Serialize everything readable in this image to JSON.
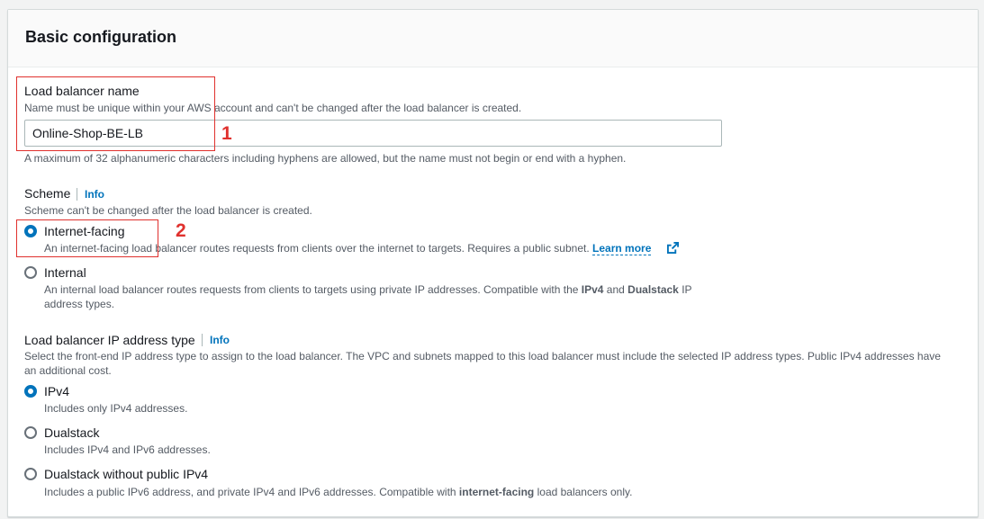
{
  "section": {
    "title": "Basic configuration"
  },
  "lb_name": {
    "label": "Load balancer name",
    "description": "Name must be unique within your AWS account and can't be changed after the load balancer is created.",
    "value": "Online-Shop-BE-LB",
    "constraint": "A maximum of 32 alphanumeric characters including hyphens are allowed, but the name must not begin or end with a hyphen."
  },
  "scheme": {
    "label": "Scheme",
    "info": "Info",
    "description": "Scheme can't be changed after the load balancer is created.",
    "options": [
      {
        "label": "Internet-facing",
        "checked": true,
        "description": "An internet-facing load balancer routes requests from clients over the internet to targets. Requires a public subnet.",
        "link": "Learn more"
      },
      {
        "label": "Internal",
        "checked": false,
        "desc_1": "An internal load balancer routes requests from clients to targets using private IP addresses. Compatible with the ",
        "desc_b1": "IPv4",
        "desc_2": " and ",
        "desc_b2": "Dualstack",
        "desc_3": " IP",
        "desc_line2": "address types."
      }
    ]
  },
  "ip_type": {
    "label": "Load balancer IP address type",
    "info": "Info",
    "description_line1": "Select the front-end IP address type to assign to the load balancer. The VPC and subnets mapped to this load balancer must include the selected IP address types. Public IPv4 addresses have",
    "description_line2": "an additional cost.",
    "options": [
      {
        "label": "IPv4",
        "checked": true,
        "description": "Includes only IPv4 addresses."
      },
      {
        "label": "Dualstack",
        "checked": false,
        "description": "Includes IPv4 and IPv6 addresses."
      },
      {
        "label": "Dualstack without public IPv4",
        "checked": false,
        "desc_1": "Includes a public IPv6 address, and private IPv4 and IPv6 addresses. Compatible with ",
        "desc_b": "internet-facing",
        "desc_2": " load balancers only."
      }
    ]
  },
  "annotations": {
    "one": "1",
    "two": "2",
    "color": "#e0312e"
  },
  "colors": {
    "accent": "#0073bb",
    "text": "#16191f",
    "muted": "#545b64"
  },
  "icons": {
    "external_link": "external-link-icon"
  }
}
